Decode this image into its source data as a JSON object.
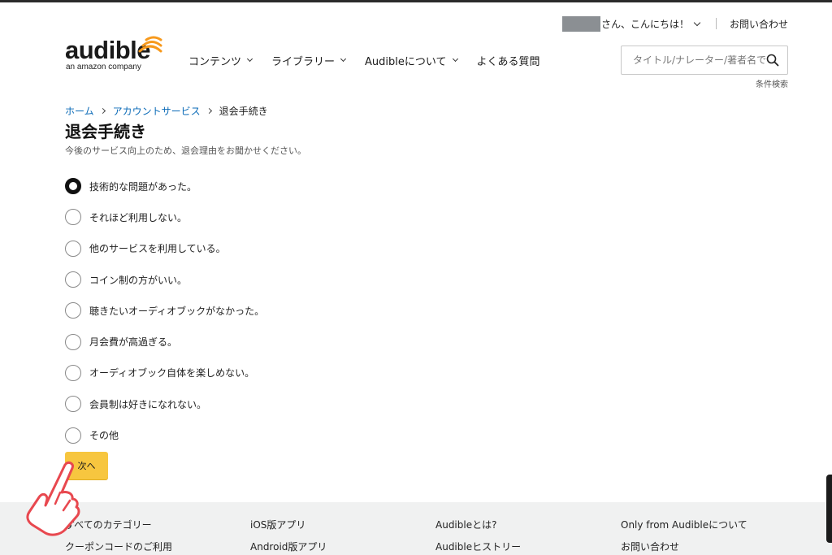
{
  "header": {
    "greeting": "さん、こんにちは！",
    "contact": "お問い合わせ",
    "logo_word": "audible",
    "logo_sub": "an amazon company",
    "nav": [
      {
        "label": "コンテンツ"
      },
      {
        "label": "ライブラリー"
      },
      {
        "label": "Audibleについて"
      },
      {
        "label": "よくある質問"
      }
    ],
    "search_placeholder": "タイトル/ナレーター/著者名で",
    "advanced_search": "条件検索"
  },
  "breadcrumb": {
    "home": "ホーム",
    "account": "アカウントサービス",
    "current": "退会手続き"
  },
  "page": {
    "title": "退会手続き",
    "subtitle": "今後のサービス向上のため、退会理由をお聞かせください。"
  },
  "options": [
    {
      "label": "技術的な問題があった。",
      "selected": true
    },
    {
      "label": "それほど利用しない。",
      "selected": false
    },
    {
      "label": "他のサービスを利用している。",
      "selected": false
    },
    {
      "label": "コイン制の方がいい。",
      "selected": false
    },
    {
      "label": "聴きたいオーディオブックがなかった。",
      "selected": false
    },
    {
      "label": "月会費が高過ぎる。",
      "selected": false
    },
    {
      "label": "オーディオブック自体を楽しめない。",
      "selected": false
    },
    {
      "label": "会員制は好きになれない。",
      "selected": false
    },
    {
      "label": "その他",
      "selected": false
    }
  ],
  "next_button": "次へ",
  "footer": {
    "col1": [
      "すべてのカテゴリー",
      "クーポンコードのご利用"
    ],
    "col2": [
      "iOS版アプリ",
      "Android版アプリ"
    ],
    "col3": [
      "Audibleとは?",
      "Audibleヒストリー"
    ],
    "col4": [
      "Only from Audibleについて",
      "お問い合わせ"
    ]
  },
  "colors": {
    "accent": "#f7c63f",
    "logo_orange": "#f7991c",
    "link": "#0a6ab7"
  }
}
